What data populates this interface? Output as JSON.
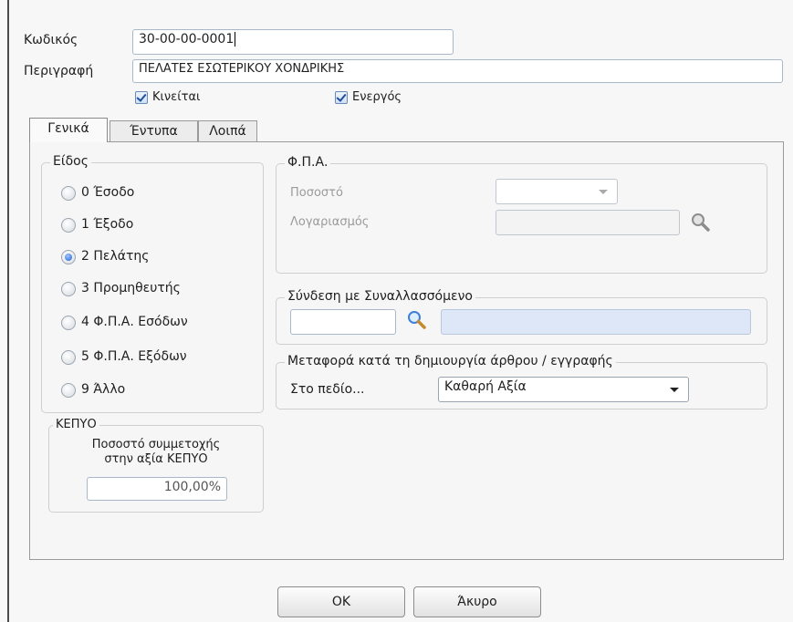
{
  "header": {
    "code_label": "Κωδικός",
    "code_value": "30-00-00-0001",
    "description_label": "Περιγραφή",
    "description_value": "ΠΕΛΑΤΕΣ ΕΣΩΤΕΡΙΚΟΥ ΧΟΝΔΡΙΚΗΣ",
    "moves_label": "Κινείται",
    "moves_checked": true,
    "active_label": "Ενεργός",
    "active_checked": true
  },
  "tabs": [
    {
      "label": "Γενικά",
      "active": true
    },
    {
      "label": "Έντυπα",
      "active": false
    },
    {
      "label": "Λοιπά",
      "active": false
    }
  ],
  "type_group": {
    "title": "Είδος",
    "options": [
      {
        "label": "0 Έσοδο",
        "selected": false
      },
      {
        "label": "1 Έξοδο",
        "selected": false
      },
      {
        "label": "2 Πελάτης",
        "selected": true
      },
      {
        "label": "3 Προμηθευτής",
        "selected": false
      },
      {
        "label": "4 Φ.Π.Α. Εσόδων",
        "selected": false
      },
      {
        "label": "5 Φ.Π.Α. Εξόδων",
        "selected": false
      },
      {
        "label": "9 Άλλο",
        "selected": false
      }
    ]
  },
  "kepyo_group": {
    "title": "ΚΕΠΥΟ",
    "percent_label_line1": "Ποσοστό συμμετοχής",
    "percent_label_line2": "στην αξία ΚΕΠΥΟ",
    "percent_value": "100,00%"
  },
  "vat_group": {
    "title": "Φ.Π.Α.",
    "rate_label": "Ποσοστό",
    "rate_value": "",
    "account_label": "Λογαριασμός",
    "account_value": ""
  },
  "link_group": {
    "title": "Σύνδεση με Συναλλασσόμενο",
    "code_value": "",
    "name_value": ""
  },
  "transfer_group": {
    "title": "Μεταφορά κατά τη δημιουργία άρθρου / εγγραφής",
    "field_label": "Στο πεδίο...",
    "field_value": "Καθαρή Αξία"
  },
  "buttons": {
    "ok_label": "OK",
    "cancel_label": "Άκυρο"
  },
  "icons": {
    "search": "magnifier-icon",
    "dropdown": "chevron-down-icon",
    "check": "checkmark-icon"
  },
  "colors": {
    "selection_blue": "#1f5fcf",
    "link_field_bg": "#dde7f7"
  }
}
